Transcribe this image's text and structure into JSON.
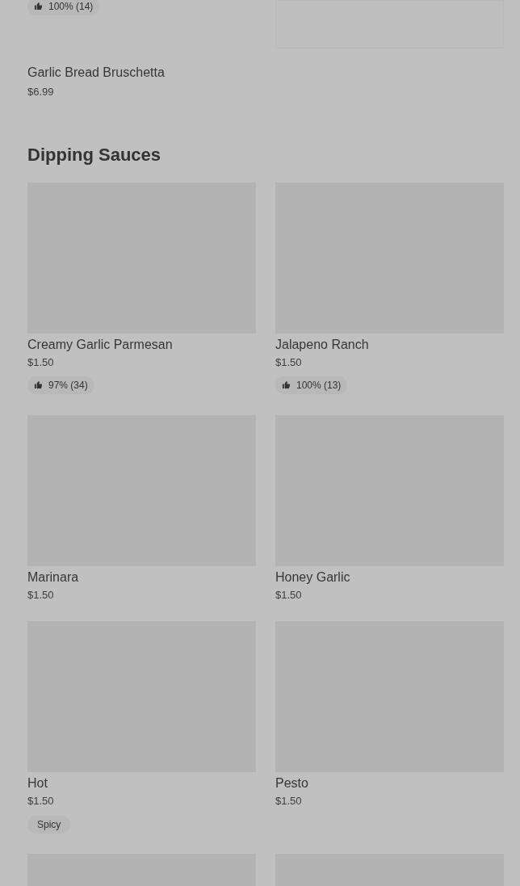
{
  "previous_item": {
    "rating": "100% (14)",
    "name": "Garlic Bread Bruschetta",
    "price": "$6.99"
  },
  "section": {
    "title": "Dipping Sauces",
    "items": [
      {
        "kind": "item",
        "name": "Creamy Garlic Parmesan",
        "price": "$1.50",
        "rating": "97% (34)"
      },
      {
        "kind": "item",
        "name": "Jalapeno Ranch",
        "price": "$1.50",
        "rating": "100% (13)"
      },
      {
        "kind": "item",
        "name": "Marinara",
        "price": "$1.50"
      },
      {
        "kind": "item",
        "name": "Honey Garlic",
        "price": "$1.50"
      },
      {
        "kind": "item",
        "name": "Hot",
        "price": "$1.50",
        "tag": "Spicy"
      },
      {
        "kind": "item",
        "name": "Pesto",
        "price": "$1.50"
      },
      {
        "kind": "image_only"
      },
      {
        "kind": "image_only"
      }
    ]
  }
}
